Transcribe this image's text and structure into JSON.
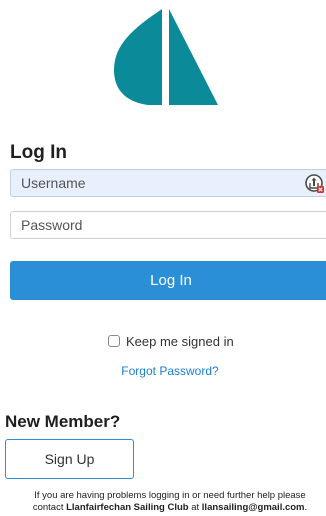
{
  "logo": {
    "icon": "sailboat-logo",
    "color": "#0b8b99"
  },
  "login": {
    "title": "Log In",
    "username_placeholder": "Username",
    "password_placeholder": "Password",
    "button_label": "Log In",
    "keep_signed_in_label": "Keep me signed in",
    "forgot_password_label": "Forgot Password?"
  },
  "new_member": {
    "title": "New Member?",
    "signup_label": "Sign Up"
  },
  "help": {
    "line1": "If you are having problems logging in or need further help please",
    "contact_prefix": "contact",
    "club_name": "Llanfairfechan Sailing Club",
    "at_word": "at",
    "email": "llansailing@gmail.com",
    "end": "."
  },
  "colors": {
    "accent": "#2a8fd6",
    "link": "#1a7fd0",
    "autofill_bg": "#e8f0fe"
  }
}
